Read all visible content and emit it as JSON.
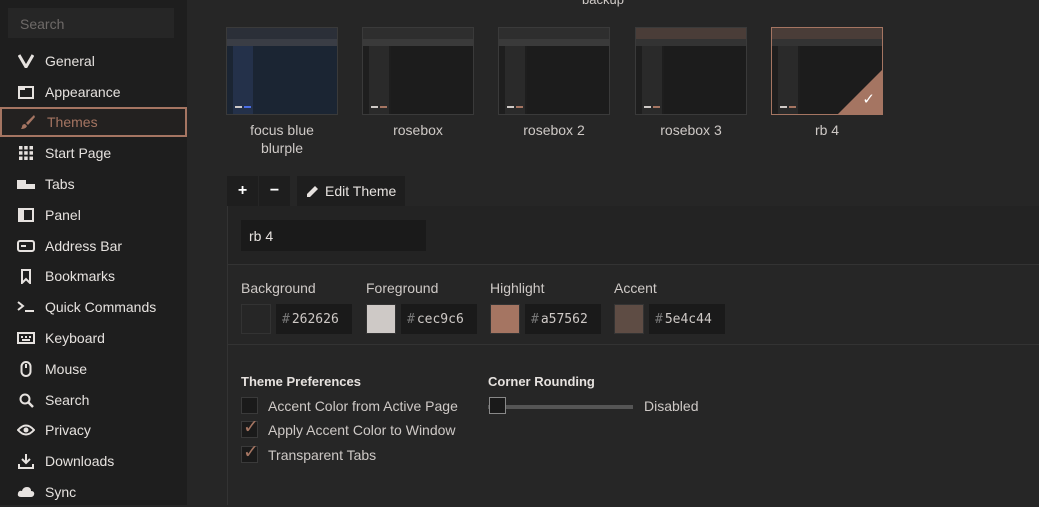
{
  "sidebar": {
    "search_placeholder": "Search",
    "items": [
      {
        "label": "General",
        "icon": "vivaldi-v-icon"
      },
      {
        "label": "Appearance",
        "icon": "folder-window-icon"
      },
      {
        "label": "Themes",
        "icon": "brush-icon",
        "active": true
      },
      {
        "label": "Start Page",
        "icon": "grid-icon"
      },
      {
        "label": "Tabs",
        "icon": "tabs-icon"
      },
      {
        "label": "Panel",
        "icon": "panel-icon"
      },
      {
        "label": "Address Bar",
        "icon": "address-bar-icon"
      },
      {
        "label": "Bookmarks",
        "icon": "bookmark-icon"
      },
      {
        "label": "Quick Commands",
        "icon": "command-prompt-icon"
      },
      {
        "label": "Keyboard",
        "icon": "keyboard-icon"
      },
      {
        "label": "Mouse",
        "icon": "mouse-icon"
      },
      {
        "label": "Search",
        "icon": "search-icon"
      },
      {
        "label": "Privacy",
        "icon": "eye-icon"
      },
      {
        "label": "Downloads",
        "icon": "download-icon"
      },
      {
        "label": "Sync",
        "icon": "cloud-icon"
      }
    ]
  },
  "themes": {
    "cut_label": "backup",
    "items": [
      {
        "name_line1": "focus blue",
        "name_line2": "blurple",
        "bg": "#1b2533",
        "accent": "#4b6ee6"
      },
      {
        "name_line1": "rosebox",
        "name_line2": "",
        "bg": "#1e1e1e",
        "accent": "#a57562"
      },
      {
        "name_line1": "rosebox 2",
        "name_line2": "",
        "bg": "#1e1e1e",
        "accent": "#a57562"
      },
      {
        "name_line1": "rosebox 3",
        "name_line2": "",
        "bg": "#1e1e1e",
        "accent": "#a57562"
      },
      {
        "name_line1": "rb 4",
        "name_line2": "",
        "bg": "#1e1e1e",
        "accent": "#a57562",
        "selected": true
      }
    ]
  },
  "toolbar": {
    "add": "+",
    "remove": "−",
    "edit_tab": "Edit Theme"
  },
  "editor": {
    "name_value": "rb 4",
    "colors": [
      {
        "label": "Background",
        "hex": "262626",
        "swatch": "#262626"
      },
      {
        "label": "Foreground",
        "hex": "cec9c6",
        "swatch": "#cec9c6"
      },
      {
        "label": "Highlight",
        "hex": "a57562",
        "swatch": "#a57562"
      },
      {
        "label": "Accent",
        "hex": "5e4c44",
        "swatch": "#5e4c44"
      }
    ],
    "prefs_heading": "Theme Preferences",
    "prefs": [
      {
        "label": "Accent Color from Active Page",
        "checked": false
      },
      {
        "label": "Apply Accent Color to Window",
        "checked": true
      },
      {
        "label": "Transparent Tabs",
        "checked": true
      }
    ],
    "rounding_heading": "Corner Rounding",
    "rounding_value": "Disabled",
    "rounding_level": 0
  }
}
